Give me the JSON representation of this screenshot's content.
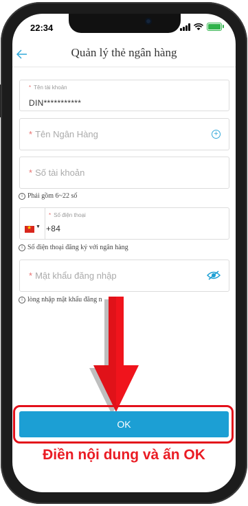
{
  "status": {
    "time": "22:34"
  },
  "header": {
    "title": "Quản lý thẻ ngân hàng"
  },
  "fields": {
    "account_name": {
      "label": "Tên tài khoản",
      "value": "DIN***********"
    },
    "bank_name": {
      "placeholder": "Tên Ngân Hàng"
    },
    "account_number": {
      "placeholder": "Số tài khoản",
      "hint": "Phải gồm 6~22 số"
    },
    "phone": {
      "label": "Số điện thoại",
      "code": "+84",
      "hint": "Số điện thoại đăng ký với ngân hàng"
    },
    "password": {
      "placeholder": "Mật khẩu đăng nhập",
      "hint": "lòng nhập mật khẩu đăng n"
    }
  },
  "actions": {
    "ok_label": "OK"
  },
  "annotation": {
    "caption": "Điền nội dung và ấn OK"
  },
  "colors": {
    "accent": "#1c9fd4",
    "annotation": "#ea1c24"
  },
  "icons": [
    "back-arrow-icon",
    "plus-circle-icon",
    "vietnam-flag-icon",
    "eye-icon",
    "info-icon",
    "signal-icon",
    "wifi-icon",
    "battery-icon"
  ]
}
